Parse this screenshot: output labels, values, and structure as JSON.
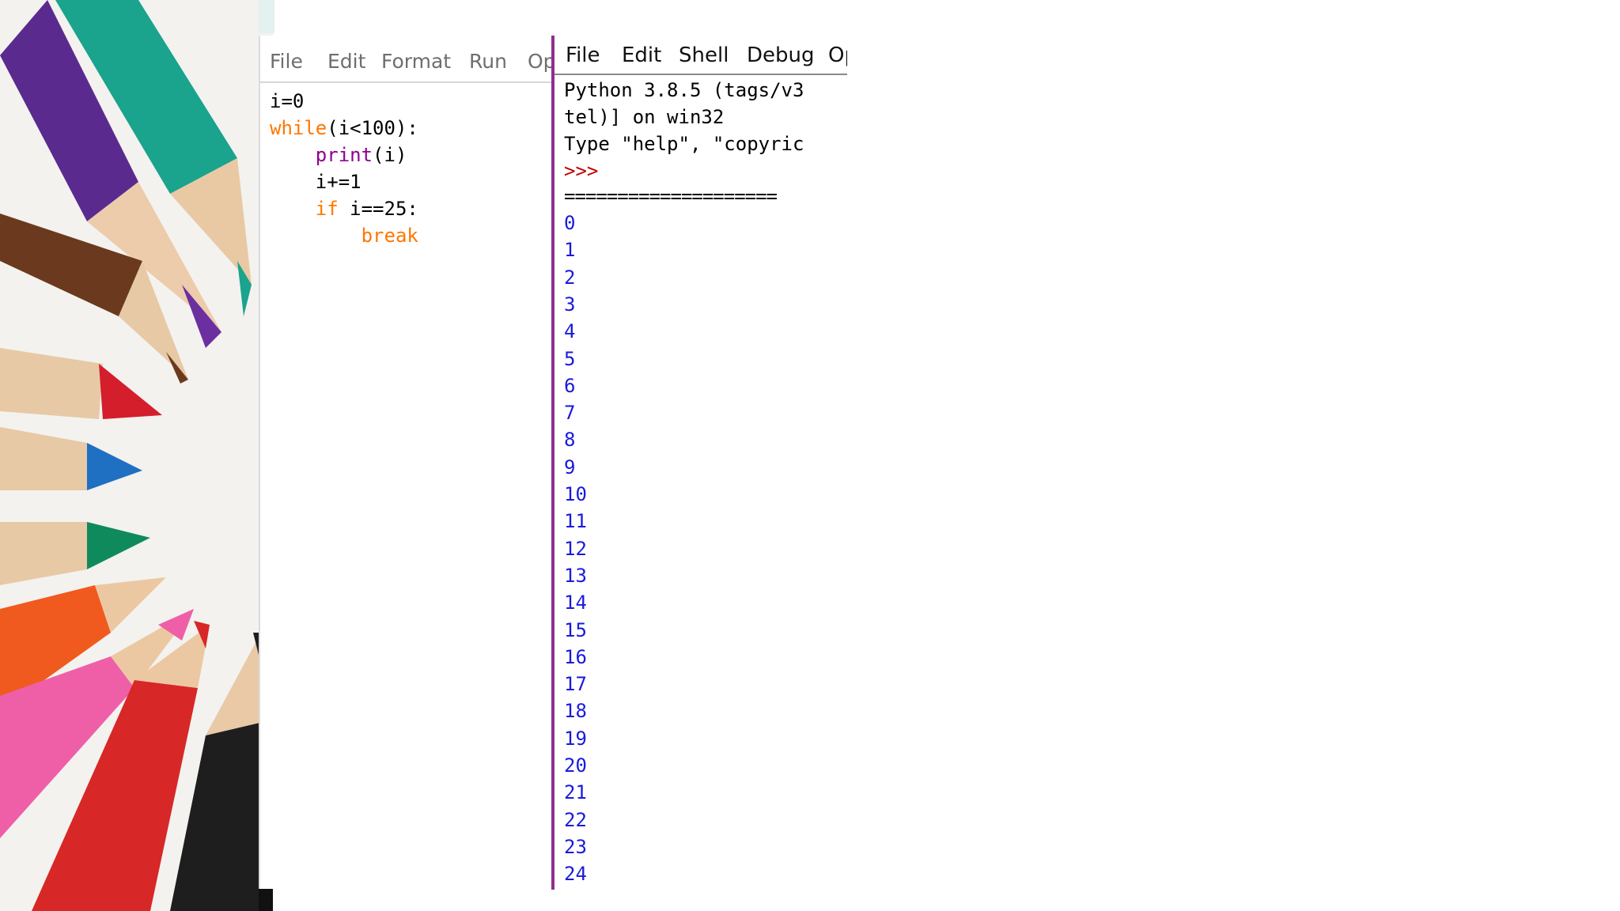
{
  "editor": {
    "menu": [
      "File",
      "Edit",
      "Format",
      "Run",
      "Options"
    ],
    "code": {
      "line1": "i=0",
      "line2_kw": "while",
      "line2_rest": "(i<100):",
      "line3_indent": "    ",
      "line3_fn": "print",
      "line3_rest": "(i)",
      "line4": "    i+=1",
      "line5_indent": "    ",
      "line5_kw": "if",
      "line5_rest": " i==25:",
      "line6_indent": "        ",
      "line6_kw": "break"
    }
  },
  "shell": {
    "menu": [
      "File",
      "Edit",
      "Shell",
      "Debug",
      "Options"
    ],
    "banner": [
      "Python 3.8.5 (tags/v3",
      "tel)] on win32",
      "Type \"help\", \"copyric"
    ],
    "prompt": ">>>",
    "restart": "====================",
    "output": [
      "0",
      "1",
      "2",
      "3",
      "4",
      "5",
      "6",
      "7",
      "8",
      "9",
      "10",
      "11",
      "12",
      "13",
      "14",
      "15",
      "16",
      "17",
      "18",
      "19",
      "20",
      "21",
      "22",
      "23",
      "24"
    ]
  },
  "colors": {
    "keyword": "#ff7700",
    "builtin": "#900090",
    "prompt": "#c00000",
    "output": "#1a1adb",
    "shell_border": "#8f2f8f"
  }
}
